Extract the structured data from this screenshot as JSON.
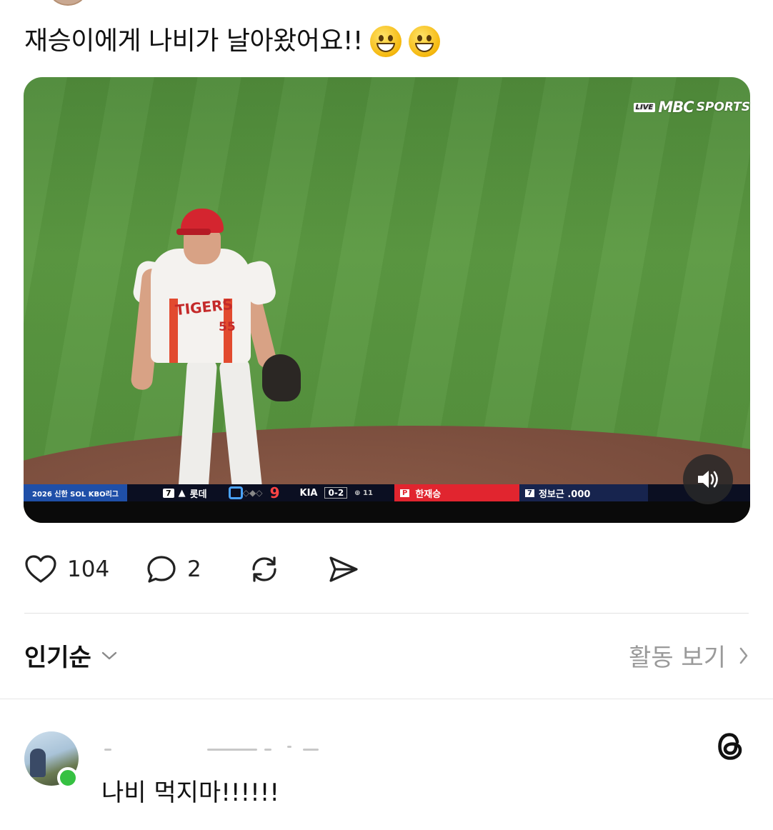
{
  "post": {
    "text": "재승이에게 나비가 날아왔어요!!",
    "emojis": [
      "grinning-face",
      "grinning-face"
    ]
  },
  "video": {
    "broadcaster": {
      "live_badge": "LIVE",
      "name": "MBC",
      "suffix": "SPORTS"
    },
    "scoreboard": {
      "league": "2026 신한 SOL KBO리그",
      "inning": "7",
      "away_team": "롯데",
      "away_score": "0",
      "home_score": "9",
      "home_team": "KIA",
      "count": "0-2",
      "pitch_count": "11",
      "pitcher_badge": "P",
      "pitcher": "한재승",
      "batter_order": "7",
      "batter": "정보근 .000"
    },
    "jersey": {
      "wordmark": "TIGERS",
      "number": "55"
    }
  },
  "actions": {
    "likes": "104",
    "comments": "2"
  },
  "sort": {
    "label": "인기순",
    "activity_link": "활동 보기"
  },
  "reply": {
    "text": "나비 먹지마!!!!!!"
  },
  "colors": {
    "online": "#36c142",
    "score_home": "#ff4444",
    "pitcher_bar": "#e1252f"
  }
}
